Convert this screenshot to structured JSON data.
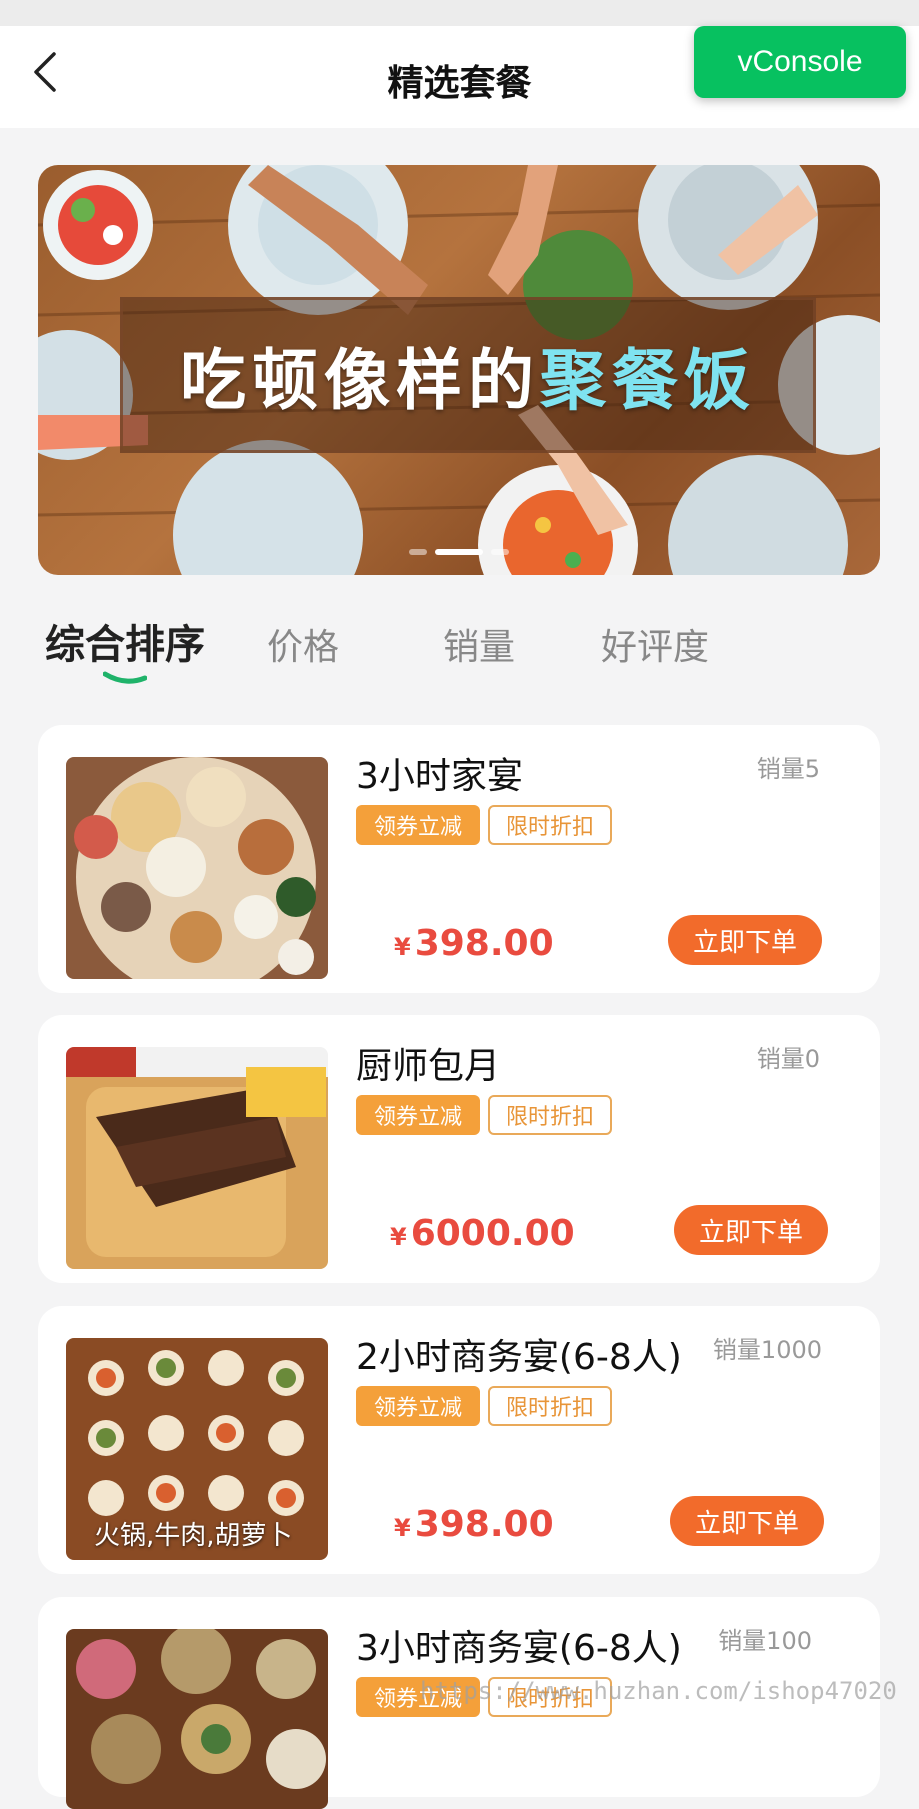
{
  "header": {
    "title": "精选套餐",
    "vconsole_label": "vConsole"
  },
  "banner": {
    "text_main": "吃顿像样的",
    "text_highlight": "聚餐饭",
    "slides_total": 3,
    "active_slide": 2
  },
  "tabs": [
    {
      "label": "综合排序",
      "active": true
    },
    {
      "label": "价格",
      "active": false
    },
    {
      "label": "销量",
      "active": false
    },
    {
      "label": "好评度",
      "active": false
    }
  ],
  "products": [
    {
      "title": "3小时家宴",
      "sales": "销量5",
      "tags": [
        "领券立减",
        "限时折扣"
      ],
      "currency": "¥",
      "price": "398.00",
      "button": "立即下单",
      "image_caption": ""
    },
    {
      "title": "厨师包月",
      "sales": "销量0",
      "tags": [
        "领券立减",
        "限时折扣"
      ],
      "currency": "¥",
      "price": "6000.00",
      "button": "立即下单",
      "image_caption": ""
    },
    {
      "title": "2小时商务宴(6-8人)",
      "sales": "销量1000",
      "tags": [
        "领券立减",
        "限时折扣"
      ],
      "currency": "¥",
      "price": "398.00",
      "button": "立即下单",
      "image_caption": "火锅,牛肉,胡萝卜"
    },
    {
      "title": "3小时商务宴(6-8人)",
      "sales": "销量100",
      "tags": [
        "领券立减",
        "限时折扣"
      ],
      "currency": "¥",
      "price": "",
      "button": "",
      "image_caption": ""
    }
  ],
  "watermark": "https://www.huzhan.com/ishop47020",
  "colors": {
    "accent_green": "#07c160",
    "price_red": "#e94b3f",
    "button_orange": "#f26b2b",
    "tag_orange": "#f4a03a"
  }
}
